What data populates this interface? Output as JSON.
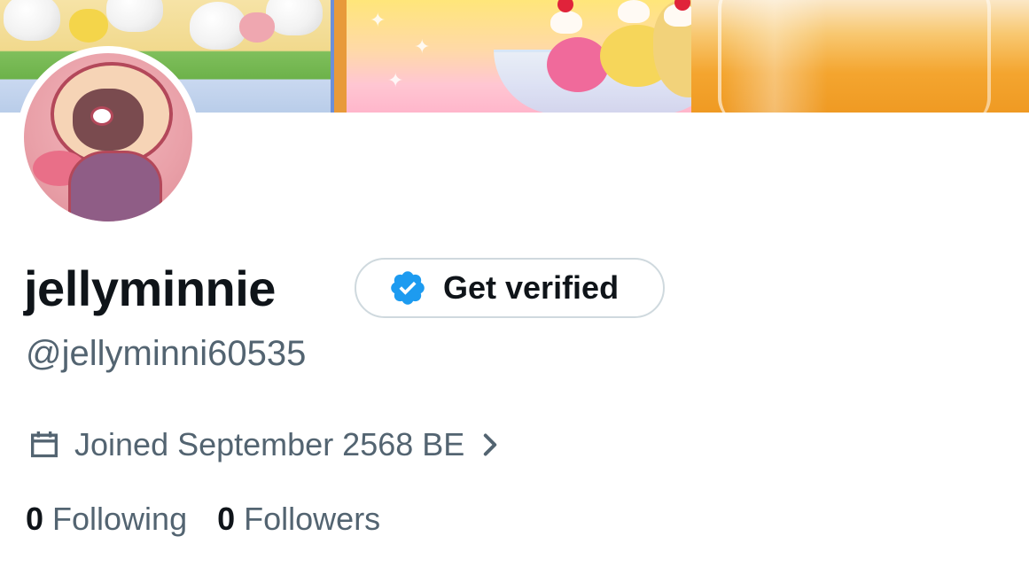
{
  "profile": {
    "display_name": "jellyminnie",
    "handle": "@jellyminni60535",
    "verify_button_label": "Get verified",
    "joined_text": "Joined September 2568 BE",
    "following": {
      "count": "0",
      "label": "Following"
    },
    "followers": {
      "count": "0",
      "label": "Followers"
    }
  },
  "icons": {
    "verified_badge": "verified-badge-icon",
    "calendar": "calendar-icon",
    "chevron": "chevron-right-icon"
  },
  "colors": {
    "primary_text": "#0f1419",
    "secondary_text": "#536471",
    "verified_blue": "#1d9bf0",
    "button_border": "#cfd9de"
  }
}
